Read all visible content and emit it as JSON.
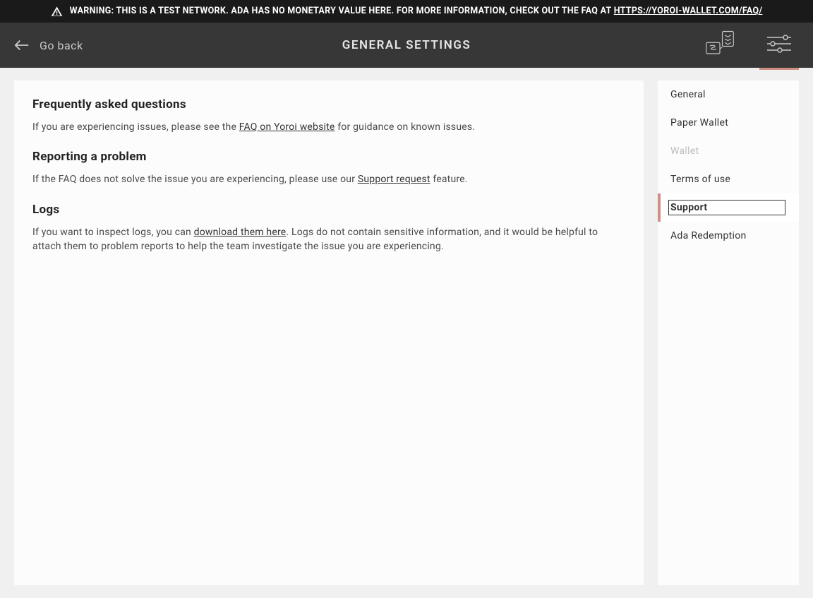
{
  "banner": {
    "text_before": "WARNING: THIS IS A TEST NETWORK. ADA HAS NO MONETARY VALUE HERE. FOR MORE INFORMATION, CHECK OUT THE FAQ AT ",
    "link_text": "HTTPS://YOROI-WALLET.COM/FAQ/"
  },
  "topbar": {
    "go_back": "Go back",
    "title": "GENERAL SETTINGS"
  },
  "content": {
    "faq": {
      "heading": "Frequently asked questions",
      "before": "If you are experiencing issues, please see the ",
      "link": "FAQ on Yoroi website",
      "after": " for guidance on known issues."
    },
    "report": {
      "heading": "Reporting a problem",
      "before": "If the FAQ does not solve the issue you are experiencing, please use our ",
      "link": "Support request",
      "after": " feature."
    },
    "logs": {
      "heading": "Logs",
      "before": "If you want to inspect logs, you can ",
      "link": "download them here",
      "after": ". Logs do not contain sensitive information, and it would be helpful to attach them to problem reports to help the team investigate the issue you are experiencing."
    }
  },
  "sidebar": {
    "items": [
      {
        "label": "General",
        "active": false,
        "disabled": false
      },
      {
        "label": "Paper Wallet",
        "active": false,
        "disabled": false
      },
      {
        "label": "Wallet",
        "active": false,
        "disabled": true
      },
      {
        "label": "Terms of use",
        "active": false,
        "disabled": false
      },
      {
        "label": "Support",
        "active": true,
        "disabled": false
      },
      {
        "label": "Ada Redemption",
        "active": false,
        "disabled": false
      }
    ]
  },
  "colors": {
    "accent": "#d08f83",
    "topbar_bg": "#373737",
    "banner_bg": "#1a1a1a",
    "page_bg": "#f0f0f0",
    "card_bg": "#fcfcfc"
  }
}
